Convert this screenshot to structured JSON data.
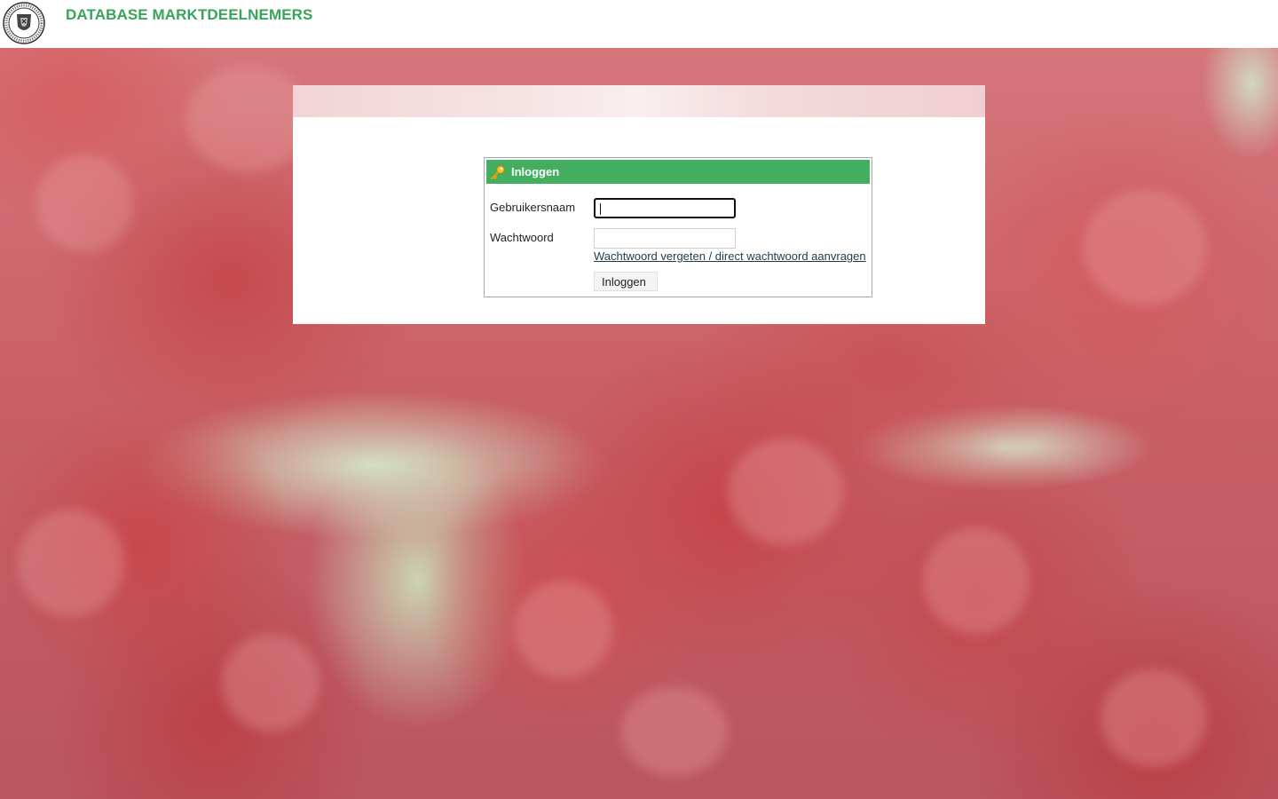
{
  "header": {
    "title": "DATABASE MARKTDEELNEMERS",
    "logo": "seal-logo"
  },
  "login": {
    "title": "Inloggen",
    "icon": "key-icon",
    "username_label": "Gebruikersnaam",
    "username_value": "",
    "password_label": "Wachtwoord",
    "password_value": "",
    "forgot_link": "Wachtwoord vergeten / direct wachtwoord aanvragen",
    "submit_label": "Inloggen"
  },
  "colors": {
    "accent": "#43ad60",
    "title": "#3aa35b",
    "link": "#1f3b4d"
  }
}
